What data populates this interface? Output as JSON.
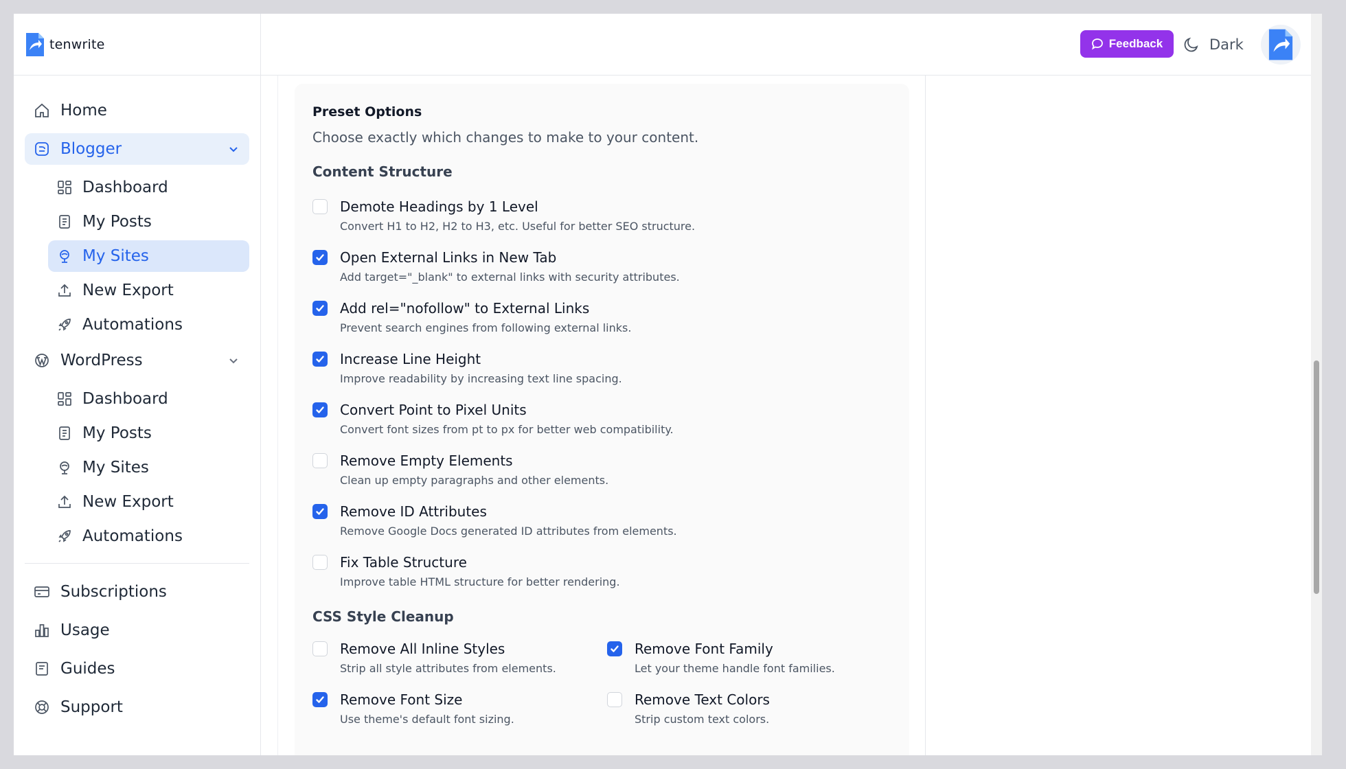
{
  "brand": {
    "name": "tenwrite"
  },
  "sidebar": {
    "home": {
      "label": "Home",
      "icon": "home-icon"
    },
    "blogger": {
      "label": "Blogger",
      "icon": "blogger-icon",
      "items": [
        {
          "label": "Dashboard",
          "icon": "dashboard-icon"
        },
        {
          "label": "My Posts",
          "icon": "document-icon"
        },
        {
          "label": "My Sites",
          "icon": "globe-icon",
          "active": true
        },
        {
          "label": "New Export",
          "icon": "upload-icon"
        },
        {
          "label": "Automations",
          "icon": "rocket-icon"
        }
      ]
    },
    "wordpress": {
      "label": "WordPress",
      "icon": "wordpress-icon",
      "items": [
        {
          "label": "Dashboard",
          "icon": "dashboard-icon"
        },
        {
          "label": "My Posts",
          "icon": "document-icon"
        },
        {
          "label": "My Sites",
          "icon": "globe-icon"
        },
        {
          "label": "New Export",
          "icon": "upload-icon"
        },
        {
          "label": "Automations",
          "icon": "rocket-icon"
        }
      ]
    },
    "bottom": [
      {
        "label": "Subscriptions",
        "icon": "card-icon"
      },
      {
        "label": "Usage",
        "icon": "bar-chart-icon"
      },
      {
        "label": "Guides",
        "icon": "book-icon"
      },
      {
        "label": "Support",
        "icon": "lifebuoy-icon"
      }
    ]
  },
  "header": {
    "feedback_label": "Feedback",
    "theme_label": "Dark"
  },
  "card": {
    "title": "Preset Options",
    "subtitle": "Choose exactly which changes to make to your content.",
    "content_structure": {
      "title": "Content Structure",
      "options": [
        {
          "label": "Demote Headings by 1 Level",
          "desc": "Convert H1 to H2, H2 to H3, etc. Useful for better SEO structure.",
          "checked": false
        },
        {
          "label": "Open External Links in New Tab",
          "desc": "Add target=\"_blank\" to external links with security attributes.",
          "checked": true
        },
        {
          "label": "Add rel=\"nofollow\" to External Links",
          "desc": "Prevent search engines from following external links.",
          "checked": true
        },
        {
          "label": "Increase Line Height",
          "desc": "Improve readability by increasing text line spacing.",
          "checked": true
        },
        {
          "label": "Convert Point to Pixel Units",
          "desc": "Convert font sizes from pt to px for better web compatibility.",
          "checked": true
        },
        {
          "label": "Remove Empty Elements",
          "desc": "Clean up empty paragraphs and other elements.",
          "checked": false
        },
        {
          "label": "Remove ID Attributes",
          "desc": "Remove Google Docs generated ID attributes from elements.",
          "checked": true
        },
        {
          "label": "Fix Table Structure",
          "desc": "Improve table HTML structure for better rendering.",
          "checked": false
        }
      ]
    },
    "css_cleanup": {
      "title": "CSS Style Cleanup",
      "options": [
        {
          "label": "Remove All Inline Styles",
          "desc": "Strip all style attributes from elements.",
          "checked": false
        },
        {
          "label": "Remove Font Family",
          "desc": "Let your theme handle font families.",
          "checked": true
        },
        {
          "label": "Remove Font Size",
          "desc": "Use theme's default font sizing.",
          "checked": true
        },
        {
          "label": "Remove Text Colors",
          "desc": "Strip custom text colors.",
          "checked": false
        }
      ]
    }
  },
  "colors": {
    "primary": "#2563eb",
    "feedback": "#9333ea"
  }
}
